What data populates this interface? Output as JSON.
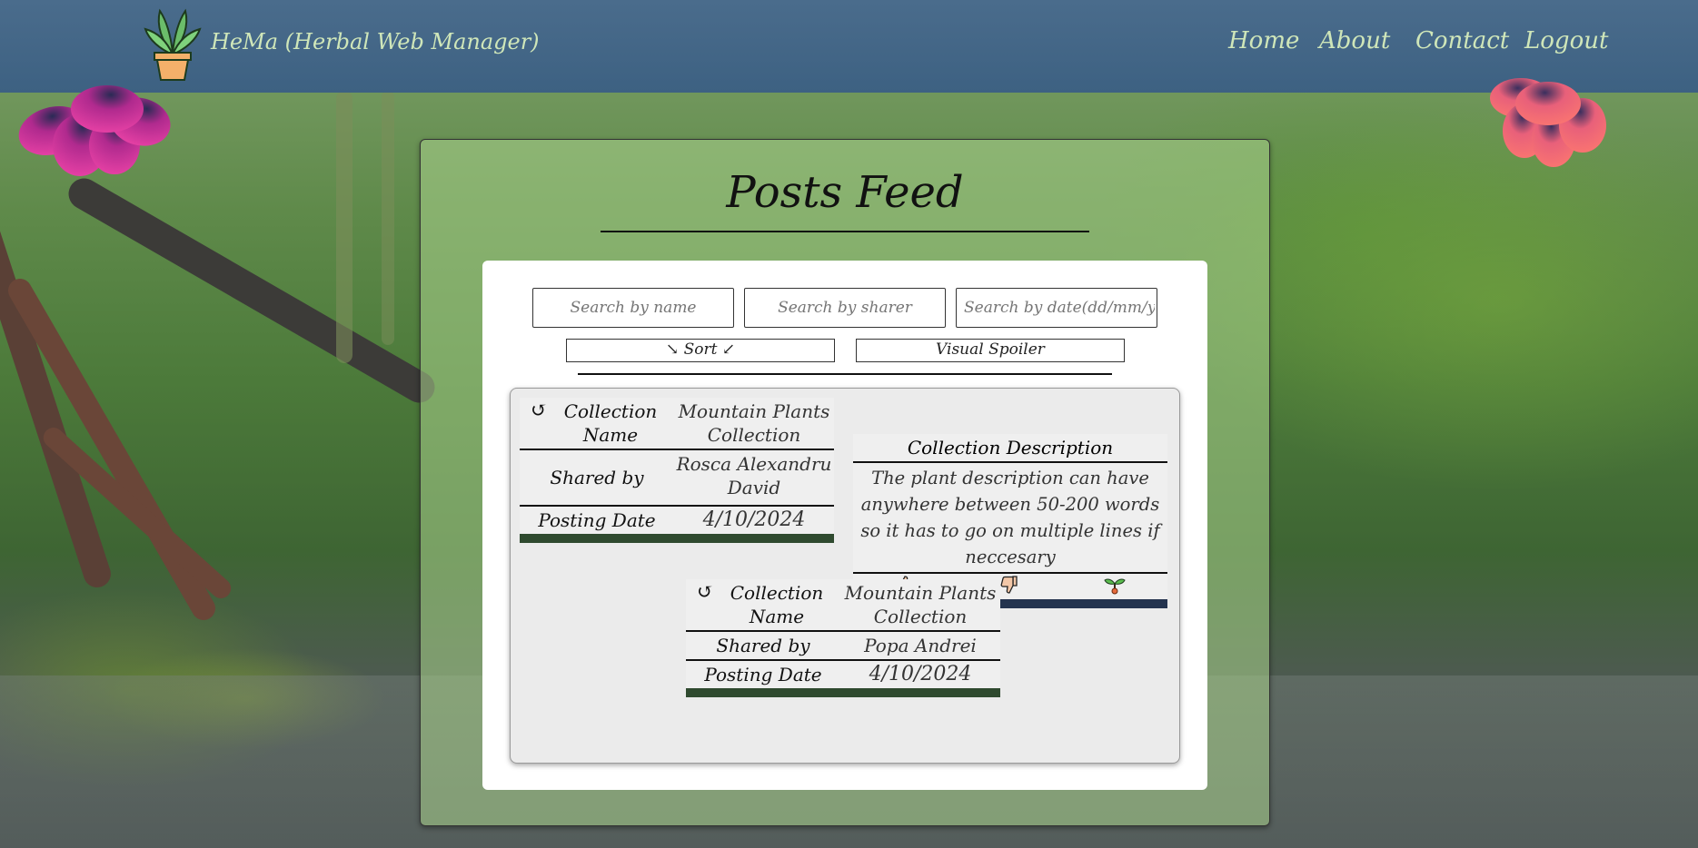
{
  "header": {
    "brand": "HeMa (Herbal Web Manager)",
    "nav": [
      {
        "label": "Home"
      },
      {
        "label": "About"
      },
      {
        "label": "Contact"
      },
      {
        "label": "Logout"
      }
    ]
  },
  "page": {
    "title": "Posts Feed"
  },
  "search": {
    "name_placeholder": "Search by name",
    "sharer_placeholder": "Search by sharer",
    "date_placeholder": "Search by date(dd/mm/yyyy)"
  },
  "controls": {
    "sort_label": "↘ Sort ↙",
    "spoiler_label": "Visual Spoiler"
  },
  "posts": [
    {
      "collection_name_key": "Collection Name",
      "collection_name": "Mountain Plants Collection",
      "shared_by_key": "Shared by",
      "shared_by": "Rosca Alexandru David",
      "posting_date_key": "Posting Date",
      "posting_date": "4/10/2024",
      "description_title": "Collection Description",
      "description": "The plant description can have anywhere between 50-200 words so it has to go on multiple lines if neccesary",
      "icons": [
        "thumbs-up-icon",
        "thumbs-down-icon",
        "sprout-icon"
      ],
      "accent_color": "#2f4a2f",
      "desc_accent_color": "#24344f"
    },
    {
      "collection_name_key": "Collection Name",
      "collection_name": "Mountain Plants Collection",
      "shared_by_key": "Shared by",
      "shared_by": "Popa Andrei",
      "posting_date_key": "Posting Date",
      "posting_date": "4/10/2024",
      "accent_color": "#2f4a2f"
    }
  ],
  "colors": {
    "topbar": "#3d6182",
    "nav_text": "#cfe6b9",
    "flower_left": "#e5379c",
    "flower_right": "#f0726e"
  }
}
